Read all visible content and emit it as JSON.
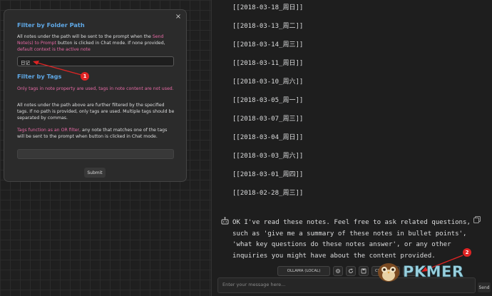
{
  "modal": {
    "close": "×",
    "folder_title": "Filter by Folder Path",
    "folder_desc": [
      {
        "text": "All notes under the path will be sent to the prompt when the ",
        "hl": false
      },
      {
        "text": "Send Note(s) to Prompt",
        "hl": true
      },
      {
        "text": " button is clicked in Chat mode. If none provided, ",
        "hl": false
      },
      {
        "text": "default context is the active note",
        "hl": true
      }
    ],
    "folder_value": "日记",
    "tags_title": "Filter by Tags",
    "tags_warning": "Only tags in note property are used, tags in note content are not used.",
    "tags_desc": "All notes under the path above are further filtered by the specified tags. If no path is provided, only tags are used. Multiple tags should be separated by commas.",
    "or_desc": [
      {
        "text": "Tags function as an OR filter,",
        "hl": true
      },
      {
        "text": " any note that matches one of the tags will be sent to the prompt when button is clicked in Chat mode.",
        "hl": false
      }
    ],
    "tags_value": "",
    "submit": "Submit"
  },
  "chat": {
    "note_links": [
      "[[2018-03-18_周日]]",
      "[[2018-03-13_周二]]",
      "[[2018-03-14_周三]]",
      "[[2018-03-11_周日]]",
      "[[2018-03-10_周六]]",
      "[[2018-03-05_周一]]",
      "[[2018-03-07_周三]]",
      "[[2018-03-04_周日]]",
      "[[2018-03-03_周六]]",
      "[[2018-03-01_周四]]",
      "[[2018-02-28_周三]]"
    ],
    "bot_message": "OK I've read these notes. Feel free to ask related questions, such as 'give me a summary of these notes in bullet points', 'what key questions do these notes answer', or any other inquiries you might have about the content provided.",
    "model": "OLLAMA (LOCAL)",
    "mode": "Chat",
    "input_placeholder": "Enter your message here...",
    "send": "Send"
  },
  "annotations": {
    "badge1": "1",
    "badge2": "2",
    "color": "#e02424"
  },
  "watermark": {
    "text": "PKMER"
  },
  "icons": {
    "copy": "copy-icon",
    "bot": "bot-icon",
    "close": "close-icon"
  }
}
